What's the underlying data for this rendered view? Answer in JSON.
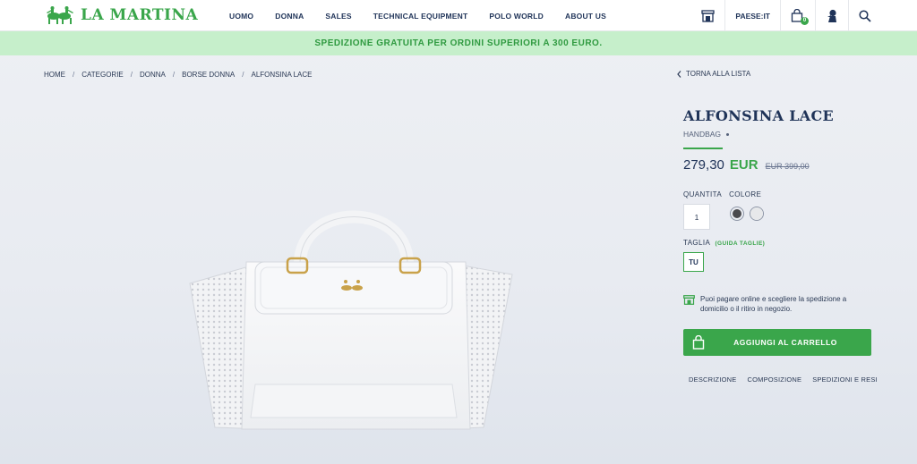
{
  "brand": {
    "name": "LA MARTINA"
  },
  "nav": [
    "UOMO",
    "DONNA",
    "SALES",
    "TECHNICAL EQUIPMENT",
    "POLO WORLD",
    "ABOUT US"
  ],
  "header_right": {
    "country": "PAESE:IT",
    "bag_count": "0",
    "icons": [
      "store-icon",
      "bag-icon",
      "user-icon",
      "search-icon"
    ]
  },
  "promo": "SPEDIZIONE GRATUITA PER ORDINI SUPERIORI A 300 EURO.",
  "breadcrumb": [
    "HOME",
    "CATEGORIE",
    "DONNA",
    "BORSE DONNA",
    "ALFONSINA LACE"
  ],
  "back_label": "TORNA ALLA LISTA",
  "product": {
    "name": "ALFONSINA LACE",
    "category": "HANDBAG",
    "price": "279,30",
    "currency": "EUR",
    "old_price": "EUR 399,00",
    "quantity_label": "QUANTITA",
    "quantity_value": "1",
    "color_label": "COLORE",
    "colors": [
      "#4a4a4e",
      "#e7e8ea"
    ],
    "size_label": "TAGLIA",
    "size_guide": "(GUIDA TAGLIE)",
    "size_value": "TU",
    "info_line1": "Puoi pagare online e scegliere la spedizione a",
    "info_line2": "domicilio o il ritiro in negozio.",
    "add_to_cart": "AGGIUNGI AL CARRELLO",
    "tabs": [
      "DESCRIZIONE",
      "COMPOSIZIONE",
      "SPEDIZIONI E RESI"
    ]
  },
  "colors": {
    "accent": "#3aa64b",
    "navy": "#1f3358",
    "promo_bg": "#c6efcb"
  }
}
